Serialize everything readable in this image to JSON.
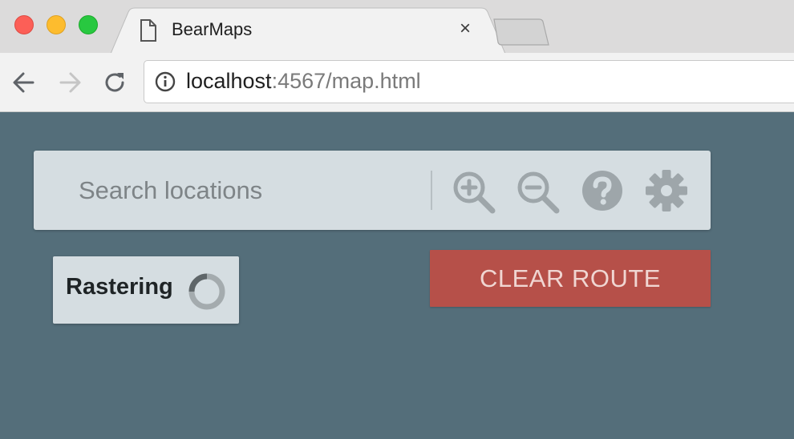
{
  "browser": {
    "tab_title": "BearMaps",
    "tab_close_glyph": "×",
    "url_host": "localhost",
    "url_rest": ":4567/map.html",
    "icons": {
      "page": "document-icon",
      "back": "back-arrow-icon",
      "forward": "forward-arrow-icon",
      "reload": "reload-icon",
      "site_info": "info-icon"
    }
  },
  "search": {
    "placeholder": "Search locations",
    "value": ""
  },
  "toolbar": {
    "icons": [
      "zoom-in-icon",
      "zoom-out-icon",
      "help-icon",
      "settings-icon"
    ],
    "icon_color": "#9ea6aa"
  },
  "route": {
    "clear_label": "CLEAR ROUTE",
    "button_color": "#b65049"
  },
  "status": {
    "label": "Rastering",
    "spinner": "loading-spinner-icon"
  },
  "colors": {
    "background": "#546e7a",
    "panel": "#d5dde1"
  }
}
